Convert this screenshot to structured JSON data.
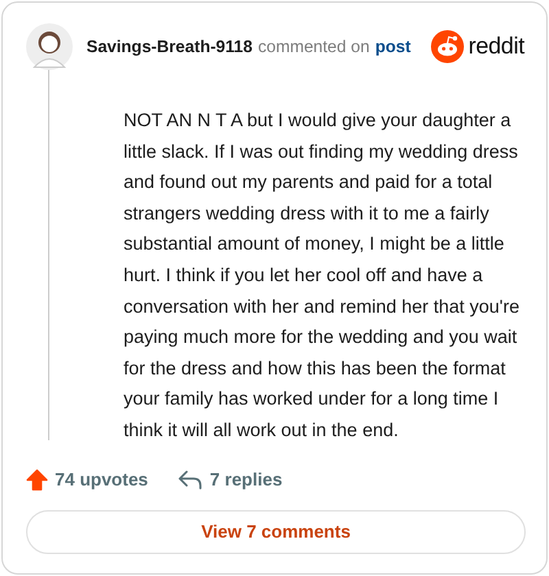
{
  "header": {
    "author": "Savings-Breath-9118",
    "action": "commented on",
    "link": "post",
    "brand": "reddit"
  },
  "comment": {
    "text": "NOT AN N T A but I would give your daughter a little slack. If I was out finding my wedding dress and found out my parents and paid for a total strangers wedding dress with it to me a fairly substantial amount of money, I might be a little hurt. I think if you let her cool off and have a conversation with her and remind her that you're paying much more for the wedding and you wait for the dress and how this has been the format your family has worked under for a long time I think it will all work out in the end."
  },
  "footer": {
    "upvotes": "74 upvotes",
    "upvoted": true,
    "replies": "7 replies"
  },
  "button": "View 7 comments"
}
